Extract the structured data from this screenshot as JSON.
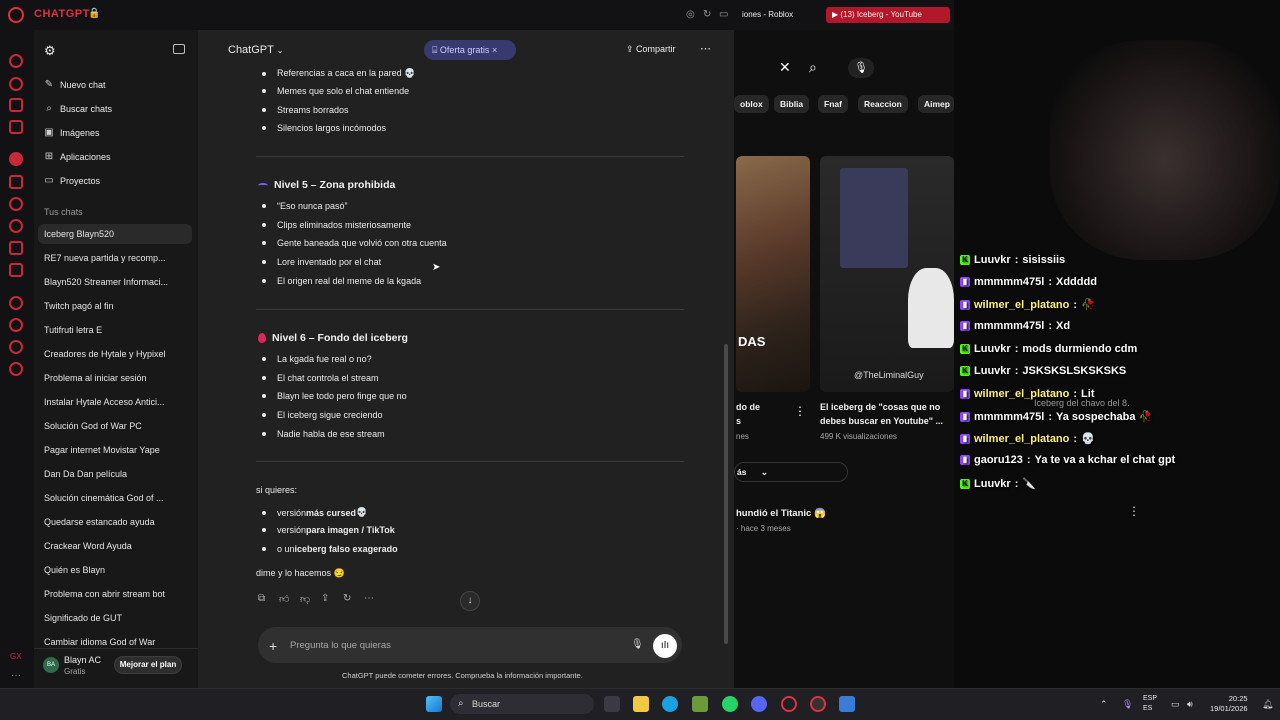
{
  "browser": {
    "brand": "CHATGPT",
    "tabs": [
      "iones - Roblox",
      "(13) Iceberg - YouTube"
    ]
  },
  "sidebar": {
    "nav": [
      {
        "label": "Nuevo chat",
        "icon": "edit-icon"
      },
      {
        "label": "Buscar chats",
        "icon": "search-icon"
      },
      {
        "label": "Imágenes",
        "icon": "image-icon"
      },
      {
        "label": "Aplicaciones",
        "icon": "grid-icon"
      },
      {
        "label": "Proyectos",
        "icon": "folder-icon"
      }
    ],
    "section_label": "Tus chats",
    "chats": [
      "Iceberg Blayn520",
      "RE7 nueva partida y recomp...",
      "Blayn520 Streamer Informaci...",
      "Twitch pagó al fin",
      "Tutifruti letra E",
      "Creadores de Hytale y Hypixel",
      "Problema al iniciar sesión",
      "Instalar Hytale Acceso Antici...",
      "Solución God of War PC",
      "Pagar internet Movistar Yape",
      "Dan Da Dan película",
      "Solución cinemática God of ...",
      "Quedarse estancado ayuda",
      "Crackear Word Ayuda",
      "Quién es Blayn",
      "Problema con abrir stream bot",
      "Significado de GUT",
      "Cambiar idioma God of War"
    ],
    "user": {
      "initials": "BA",
      "name": "Blayn AC",
      "plan": "Gratis",
      "upgrade": "Mejorar el plan"
    }
  },
  "header": {
    "model": "ChatGPT",
    "offer": "Oferta gratis",
    "share": "Compartir"
  },
  "conversation": {
    "top_bullets": [
      "Referencias a caca en la pared 💀",
      "Memes que solo el chat entiende",
      "Streams borrados",
      "Silencios largos incómodos"
    ],
    "level5": {
      "title": "Nivel 5 – Zona prohibida",
      "items": [
        "“Eso nunca pasó”",
        "Clips eliminados misteriosamente",
        "Gente baneada que volvió con otra cuenta",
        "Lore inventado por el chat",
        "El origen real del meme de la kgada"
      ]
    },
    "level6": {
      "title": "Nivel 6 – Fondo del iceberg",
      "items": [
        "La kgada fue real o no?",
        "El chat controla el stream",
        "Blayn lee todo pero finge que no",
        "El iceberg sigue creciendo",
        "Nadie habla de ese stream"
      ]
    },
    "outro_intro": "si quieres:",
    "outro_items": [
      {
        "pre": "versión ",
        "bold": "más cursed",
        "post": " 💀"
      },
      {
        "pre": "versión ",
        "bold": "para imagen / TikTok",
        "post": ""
      },
      {
        "pre": "o un ",
        "bold": "iceberg falso exagerado",
        "post": ""
      }
    ],
    "closing": "dime y lo hacemos 😏"
  },
  "composer": {
    "placeholder": "Pregunta lo que quieras",
    "disclaimer": "ChatGPT puede cometer errores. Comprueba la información importante."
  },
  "youtube": {
    "chips": [
      "oblox",
      "Biblia",
      "Fnaf",
      "Reaccion",
      "Aimep"
    ],
    "videos": [
      {
        "title": "do de\ns",
        "meta": "nes"
      },
      {
        "title": "El iceberg de \"cosas que no debes buscar en Youtube\" ...",
        "meta": "499 K visualizaciones",
        "watermark": "@TheLiminalGuy"
      }
    ],
    "more": "ás",
    "video2_title": "hundió el Titanic 😱",
    "video2_meta": "· hace 3 meses"
  },
  "stream_chat": [
    {
      "platform": "kick",
      "user": "Luuvkr",
      "msg": "sisissiis"
    },
    {
      "platform": "twitch",
      "user": "mmmmm475l",
      "msg": "Xddddd"
    },
    {
      "platform": "twitch",
      "user": "wilmer_el_platano",
      "msg": "🥀",
      "yellow": true
    },
    {
      "platform": "twitch",
      "user": "mmmmm475l",
      "msg": "Xd"
    },
    {
      "platform": "kick",
      "user": "Luuvkr",
      "msg": "mods durmiendo cdm"
    },
    {
      "platform": "kick",
      "user": "Luuvkr",
      "msg": "JSKSKSLSKSKSKS"
    },
    {
      "platform": "twitch",
      "user": "wilmer_el_platano",
      "msg": "Lit",
      "yellow": true
    },
    {
      "platform": "twitch",
      "user": "mmmmm475l",
      "msg": "Ya sospechaba 🥀"
    },
    {
      "platform": "twitch",
      "user": "wilmer_el_platano",
      "msg": "💀",
      "yellow": true
    },
    {
      "platform": "twitch",
      "user": "gaoru123",
      "msg": "Ya te va a kchar el chat gpt"
    },
    {
      "platform": "kick",
      "user": "Luuvkr",
      "msg": "🔪"
    }
  ],
  "taskbar": {
    "search": "Buscar",
    "lang": "ESP\nES",
    "time": "20:25",
    "date": "19/01/2026"
  },
  "colors": {
    "accent": "#e0313f",
    "kick": "#53fc18",
    "twitch": "#9146ff",
    "offer": "#373a6e"
  }
}
